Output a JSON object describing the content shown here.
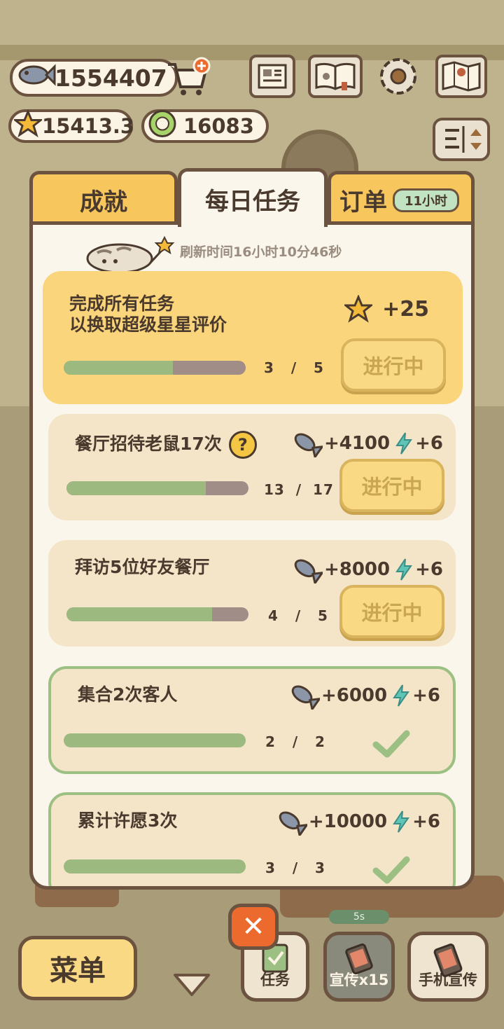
{
  "hud": {
    "fish": "1554407",
    "stars": "15413.3",
    "coins": "16083"
  },
  "tabs": {
    "achievements": "成就",
    "daily": "每日任务",
    "orders": "订单",
    "orders_timer": "11小时"
  },
  "panel": {
    "refresh_text": "刷新时间16小时10分46秒"
  },
  "tasks": [
    {
      "title_line1": "完成所有任务",
      "title_line2": "以换取超级星星评价",
      "reward": "+25",
      "current": "3",
      "total": "5",
      "sep": "/",
      "progress": 0.6,
      "button": "进行中"
    },
    {
      "title": "餐厅招待老鼠17次",
      "help": "?",
      "reward_fish": "+4100",
      "reward_energy": "+6",
      "current": "13",
      "total": "17",
      "sep": "/",
      "progress": 0.765,
      "button": "进行中"
    },
    {
      "title": "拜访5位好友餐厅",
      "reward_fish": "+8000",
      "reward_energy": "+6",
      "current": "4",
      "total": "5",
      "sep": "/",
      "progress": 0.8,
      "button": "进行中"
    },
    {
      "title": "集合2次客人",
      "reward_fish": "+6000",
      "reward_energy": "+6",
      "current": "2",
      "total": "2",
      "sep": "/",
      "progress": 1.0
    },
    {
      "title": "累计许愿3次",
      "reward_fish": "+10000",
      "reward_energy": "+6",
      "current": "3",
      "total": "3",
      "sep": "/",
      "progress": 1.0
    }
  ],
  "bottom": {
    "menu": "菜单",
    "task": "任务",
    "promo": "宣传x15",
    "promo_timer": "5s",
    "phone": "手机宣传",
    "close": "✕"
  },
  "colors": {
    "tab_active": "#fbf6ec",
    "tab_inactive": "#f7c65c",
    "progress_fill": "#9cb980",
    "progress_track": "#a08d88",
    "done_border": "#9cc083",
    "close_button": "#ec6a2d"
  },
  "icons": [
    "fish-icon",
    "star-icon",
    "coin-icon",
    "cart-icon",
    "newspaper-icon",
    "recipe-book-icon",
    "gear-icon",
    "map-icon",
    "sort-icon",
    "energy-icon",
    "check-icon",
    "help-icon",
    "close-icon",
    "chevron-down-icon",
    "clipboard-icon",
    "phone-icon"
  ]
}
